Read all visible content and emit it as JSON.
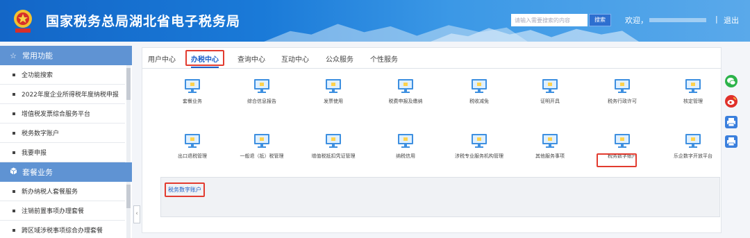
{
  "header": {
    "title": "国家税务总局湖北省电子税务局",
    "search_placeholder": "请输入需要搜索的内容",
    "search_button": "搜索",
    "welcome": "欢迎，",
    "separator": "|",
    "logout": "退出"
  },
  "sidebar": {
    "section_common": "常用功能",
    "common_items": [
      {
        "label": "全功能搜索"
      },
      {
        "label": "2022年度企业所得税年度纳税申报"
      },
      {
        "label": "增值税发票综合服务平台"
      },
      {
        "label": "税务数字账户"
      },
      {
        "label": "我要申报"
      }
    ],
    "section_package": "套餐业务",
    "package_items": [
      {
        "label": "新办纳税人套餐服务"
      },
      {
        "label": "注销前置事项办理套餐"
      },
      {
        "label": "跨区域涉税事项综合办理套餐"
      }
    ],
    "collapse_glyph": "‹"
  },
  "tabs": [
    {
      "label": "用户中心"
    },
    {
      "label": "办税中心",
      "active": true
    },
    {
      "label": "查询中心"
    },
    {
      "label": "互动中心"
    },
    {
      "label": "公众服务"
    },
    {
      "label": "个性服务"
    }
  ],
  "services_row1": [
    {
      "label": "套餐业务"
    },
    {
      "label": "综合信息报告"
    },
    {
      "label": "发票使用"
    },
    {
      "label": "税费申报及缴纳"
    },
    {
      "label": "税收减免"
    },
    {
      "label": "证明开具"
    },
    {
      "label": "税务行政许可"
    },
    {
      "label": "核定管理"
    }
  ],
  "services_row2": [
    {
      "label": "出口退税管理"
    },
    {
      "label": "一般退（抵）税管理"
    },
    {
      "label": "增值税抵扣凭证管理"
    },
    {
      "label": "纳税信用"
    },
    {
      "label": "涉税专业服务机构管理"
    },
    {
      "label": "其他服务事项"
    },
    {
      "label": "税务数字账户",
      "highlighted": true
    },
    {
      "label": "乐企数字开放平台"
    }
  ],
  "sub_panel": {
    "link": "税务数字账户"
  },
  "float_icons": [
    "wechat-icon",
    "weibo-icon",
    "print-icon",
    "print-icon"
  ],
  "colors": {
    "header_blue": "#1a7ad8",
    "sidebar_header": "#5f93d3",
    "active_tab": "#1b5fc9",
    "highlight_red": "#e23b2f",
    "monitor_blue": "#3d8fe0",
    "monitor_screen": "#ffd24d"
  }
}
